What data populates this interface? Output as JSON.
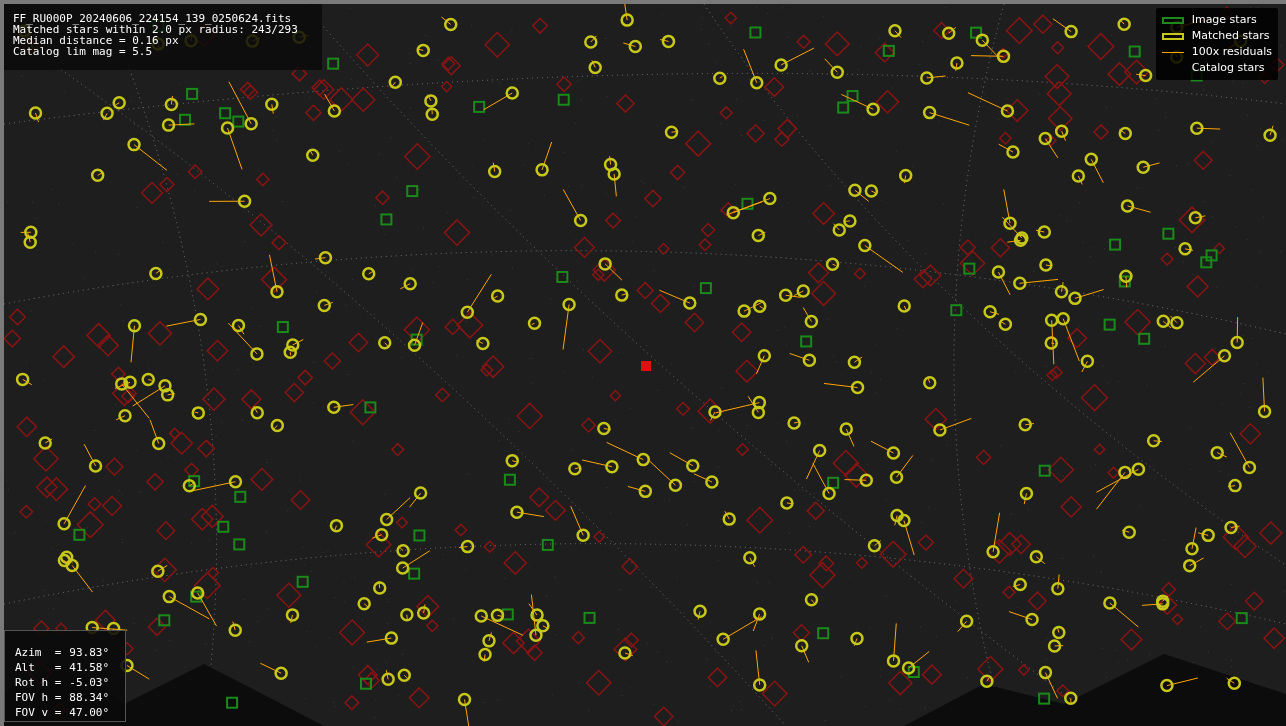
{
  "file_info": {
    "lines": [
      "FF_RU000P_20240606_224154_139_0250624.fits",
      "Matched stars within 2.0 px radius: 243/293",
      "Median distance = 0.16 px",
      "Catalog lim mag = 5.5"
    ]
  },
  "legend": [
    {
      "kind": "image",
      "label": "Image stars"
    },
    {
      "kind": "matched",
      "label": "Matched stars"
    },
    {
      "kind": "residual",
      "label": "100x residuals"
    },
    {
      "kind": "catalog",
      "label": "Catalog stars"
    }
  ],
  "pointing": [
    {
      "label": "Azim  =",
      "value": "93.83°"
    },
    {
      "label": "Alt   =",
      "value": "41.58°"
    },
    {
      "label": "Rot h =",
      "value": "-5.03°"
    },
    {
      "label": "FOV h =",
      "value": "88.34°"
    },
    {
      "label": "FOV v =",
      "value": "47.00°"
    }
  ]
}
